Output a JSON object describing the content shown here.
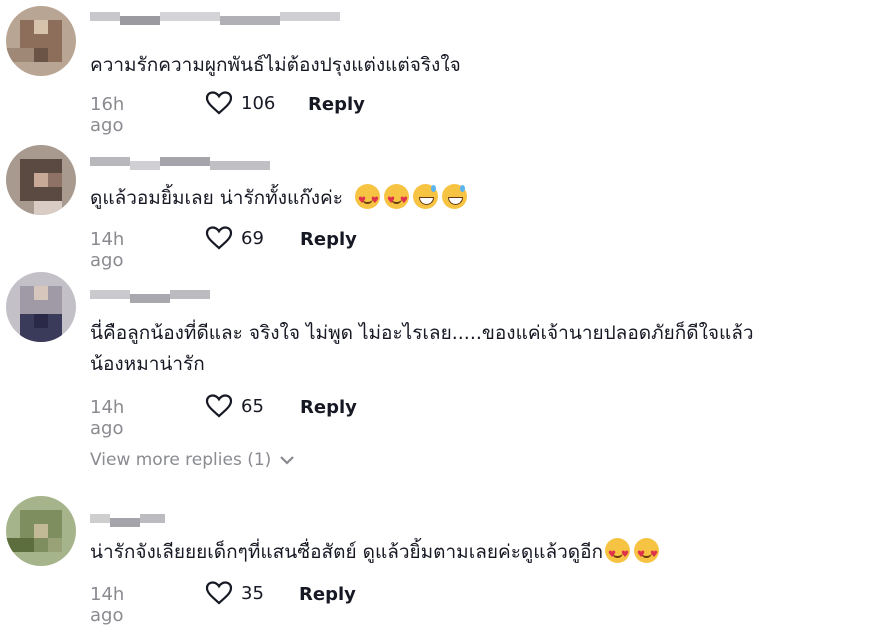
{
  "comments": [
    {
      "text": "ความรักความผูกพันธ์ไม่ต้องปรุงแต่งแต่จริงใจ",
      "time": "16h ago",
      "likes": "106",
      "reply": "Reply",
      "emojis": []
    },
    {
      "text": "ดูแล้วอมยิ้มเลย น่ารักทั้งแก๊งค่ะ",
      "time": "14h ago",
      "likes": "69",
      "reply": "Reply",
      "emojis": [
        "smiling-face-with-hearts",
        "smiling-face-with-hearts",
        "grinning-face-with-sweat",
        "grinning-face-with-sweat"
      ]
    },
    {
      "text": "นี่คือลูกน้องที่ดีและ จริงใจ ไม่พูด ไม่อะไรเลย.....ของแค่เจ้านายปลอดภัยก็ดีใจแล้ว",
      "text2": "น้องหมาน่ารัก",
      "time": "14h ago",
      "likes": "65",
      "reply": "Reply",
      "emojis": []
    },
    {
      "text": "น่ารักจังเลียยยเด็กๆที่แสนซื่อสัตย์ ดูแล้วยิ้มตามเลยค่ะดูแล้วดูอีก",
      "time": "14h ago",
      "likes": "35",
      "reply": "Reply",
      "emojis": [
        "smiling-face-with-hearts",
        "smiling-face-with-hearts"
      ]
    }
  ],
  "view_more": "View more replies (1)",
  "colors": {
    "text": "#161823",
    "muted": "#8a8b91",
    "background": "#ffffff"
  }
}
